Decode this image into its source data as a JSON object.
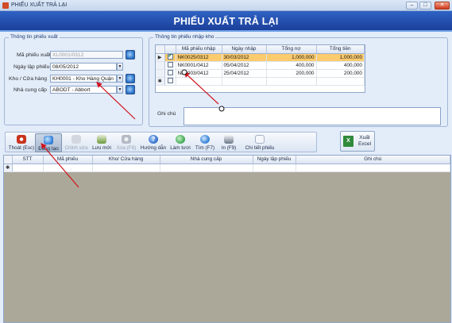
{
  "window": {
    "title": "PHIẾU XUẤT TRẢ LẠI",
    "minimize": "–",
    "maximize": "□",
    "close": "✕"
  },
  "banner": {
    "title": "PHIẾU XUẤT TRẢ LẠI"
  },
  "info": {
    "legend": "Thông tin phiếu xuất",
    "ma_phieu_xuat": {
      "label": "Mã phiếu xuất",
      "value": "XL0001/0312"
    },
    "ngay_lap_phieu": {
      "label": "Ngày lập phiếu",
      "value": "08/05/2012"
    },
    "kho": {
      "label": "Kho / Cửa hàng",
      "value": "KH0001 - Kho Hàng Quận"
    },
    "ncc": {
      "label": "Nhà cung cấp",
      "value": "ABODT - Abbort"
    }
  },
  "import_grid": {
    "legend": "Thông tin phiếu nhập kho",
    "columns": [
      "Mã phiếu nhập",
      "Ngày nhập",
      "Tổng nợ",
      "Tổng tiền"
    ],
    "rows": [
      {
        "indicator": "▶",
        "checked": true,
        "ma": "NK0025/0312",
        "ngay": "30/03/2012",
        "tong_no": "1,000,000",
        "tong_tien": "1,000,000",
        "selected": true
      },
      {
        "indicator": "",
        "checked": false,
        "ma": "NK0001/0412",
        "ngay": "05/04/2012",
        "tong_no": "400,000",
        "tong_tien": "400,000",
        "selected": false
      },
      {
        "indicator": "",
        "checked": false,
        "ma": "NK0003/0412",
        "ngay": "25/04/2012",
        "tong_no": "200,000",
        "tong_tien": "200,000",
        "selected": false
      }
    ],
    "new_row_indicator": "✱"
  },
  "note": {
    "label": "Ghi chú"
  },
  "toolbar": {
    "buttons": [
      {
        "label": "Thoát (Esc)",
        "color": "#c8321c",
        "disabled": false,
        "active": false
      },
      {
        "label": "Đang tạo",
        "color": "#2f7ad6",
        "disabled": false,
        "active": true
      },
      {
        "label": "Chỉnh sửa",
        "color": "#c9cfd8",
        "disabled": true,
        "active": false
      },
      {
        "label": "Lưu mới",
        "color": "#6a9a3a",
        "disabled": false,
        "active": false
      },
      {
        "label": "Xóa (F8)",
        "color": "#c9cfd8",
        "disabled": true,
        "active": false
      },
      {
        "label": "Hướng dẫn",
        "color": "#2e6bc9",
        "disabled": false,
        "active": false
      },
      {
        "label": "Làm tươi",
        "color": "#3aa54a",
        "disabled": false,
        "active": false
      },
      {
        "label": "Tìm (F7)",
        "color": "#3b86d8",
        "disabled": false,
        "active": false
      },
      {
        "label": "In (F9)",
        "color": "#6b7788",
        "disabled": false,
        "active": false
      },
      {
        "label": "Chi tiết phiếu",
        "color": "#e9edf3",
        "disabled": false,
        "active": false
      }
    ],
    "excel_label": "Xuất Excel",
    "excel_glyph": "X"
  },
  "detail_grid": {
    "columns": [
      "STT",
      "Mã phiếu",
      "Kho/ Cửa hàng",
      "Nhà cung cấp",
      "Ngày lập phiếu",
      "Ghi chú"
    ],
    "new_row_indicator": "✱"
  },
  "colors": {
    "banner": "#2452b0",
    "selected_row": "#fbcb6d",
    "grid_empty": "#aca899",
    "annotation_arrow": "#d0141e"
  }
}
